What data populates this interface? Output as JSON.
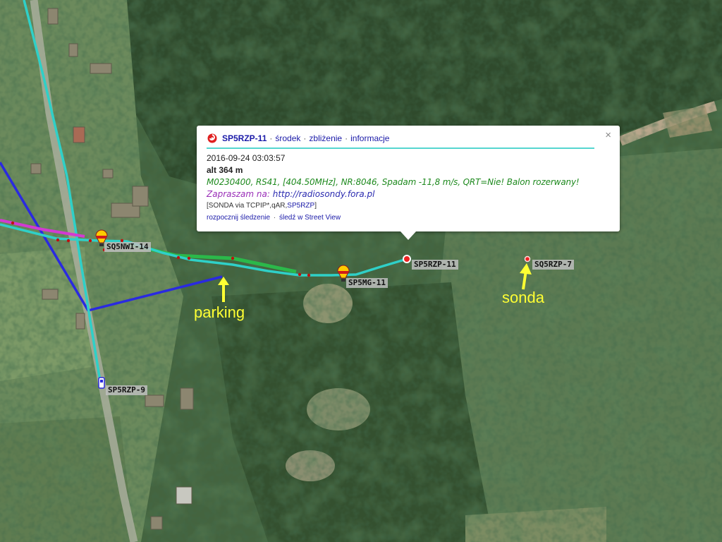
{
  "map": {
    "colors": {
      "cyan_track": "#2fd0c8",
      "blue_track": "#2a2ae0",
      "magenta_track": "#d23ad2",
      "green_track": "#2bb84a",
      "annotation": "#ffff33"
    },
    "stations": [
      {
        "callsign": "SQ5NWI-14",
        "icon": "balloon-icon"
      },
      {
        "callsign": "SP5MG-11",
        "icon": "balloon-icon"
      },
      {
        "callsign": "SP5RZP-11",
        "icon": "red-dot-icon"
      },
      {
        "callsign": "SQ5RZP-7",
        "icon": "red-dot-icon"
      },
      {
        "callsign": "SP5RZP-9",
        "icon": "car-icon"
      }
    ],
    "annotations": {
      "parking": "parking",
      "sonda": "sonda"
    }
  },
  "popup": {
    "icon": "aprs-symbol-icon",
    "callsign": "SP5RZP-11",
    "links": {
      "center": "środek",
      "zoom": "zbliżenie",
      "info": "informacje"
    },
    "separator": "·",
    "close": "×",
    "timestamp": "2016-09-24 03:03:57",
    "altitude": "alt 364 m",
    "comment": "M0230400, RS41, [404.50MHz], NR:8046, Spadam -11,8 m/s, QRT=Nie! Balon rozerwany!",
    "invite_prefix": "Zapraszam na:",
    "invite_url": "http://radiosondy.fora.pl",
    "path_prefix": "[SONDA via TCPIP*,qAR,",
    "path_link": "SP5RZP",
    "path_suffix": "]",
    "start_tracking": "rozpocznij śledzenie",
    "street_view": "śledź w Street View"
  }
}
